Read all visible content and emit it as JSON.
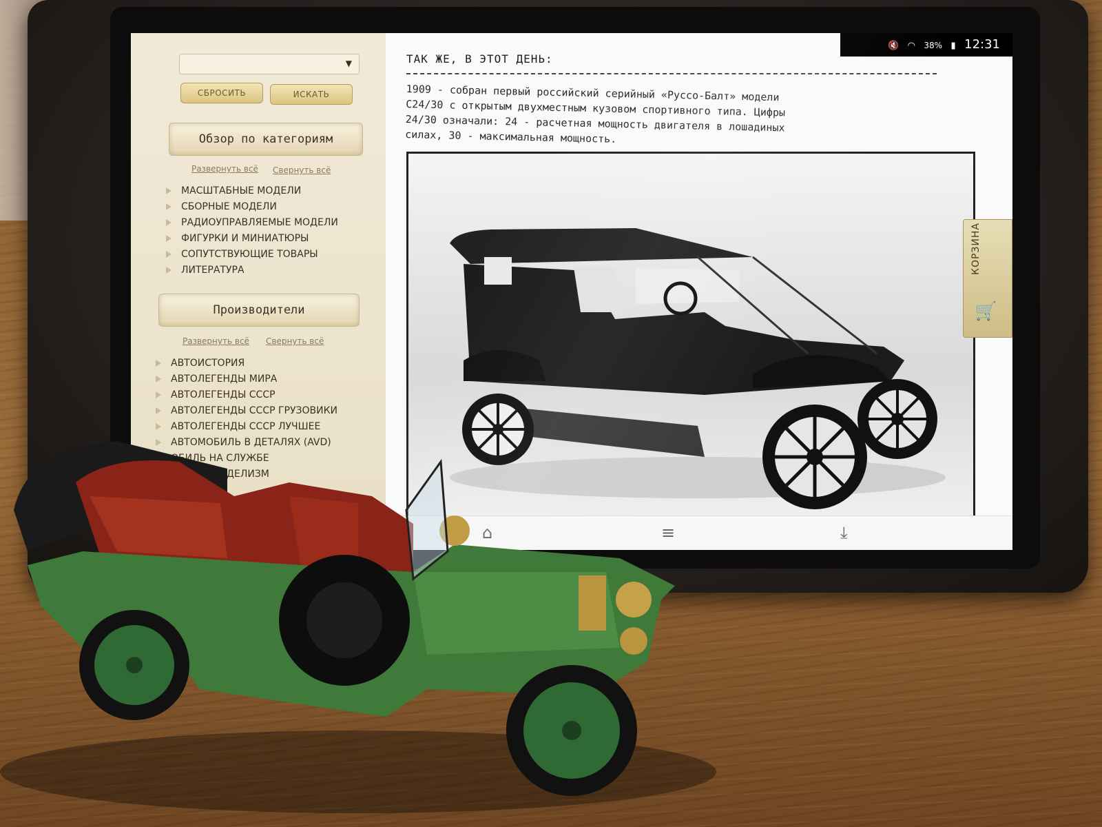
{
  "sidebar": {
    "reset_button": "СБРОСИТЬ",
    "search_button": "ИСКАТЬ",
    "categories_title": "Обзор по категориям",
    "categories_expand": "Развернуть всё",
    "categories_collapse": "Свернуть всё",
    "categories": [
      "МАСШТАБНЫЕ МОДЕЛИ",
      "СБОРНЫЕ МОДЕЛИ",
      "РАДИОУПРАВЛЯЕМЫЕ МОДЕЛИ",
      "ФИГУРКИ И МИНИАТЮРЫ",
      "СОПУТСТВУЮЩИЕ ТОВАРЫ",
      "ЛИТЕРАТУРА"
    ],
    "manufacturers_title": "Производители",
    "manufacturers_expand": "Развернуть всё",
    "manufacturers_collapse": "Свернуть всё",
    "manufacturers": [
      "АВТОИСТОРИЯ",
      "АВТОЛЕГЕНДЫ МИРА",
      "АВТОЛЕГЕНДЫ СССР",
      "АВТОЛЕГЕНДЫ СССР ГРУЗОВИКИ",
      "АВТОЛЕГЕНДЫ СССР ЛУЧШЕЕ",
      "АВТОМОБИЛЬ В ДЕТАЛЯХ (AVD)",
      "ОБИЛЬ НА СЛУЖБЕ",
      "ЛЬНЫЙ МОДЕЛИЗМ"
    ]
  },
  "status_bar": {
    "battery": "38%",
    "time": "12:31"
  },
  "article": {
    "heading": "ТАК ЖЕ, В ЭТОТ ДЕНЬ:",
    "lines": [
      "1909 - собран первый российский серийный «Руссо-Балт» модели",
      "С24/30 с открытым двухместным кузовом спортивного типа. Цифры",
      "24/30 означали: 24 - расчетная мощность двигателя в лошадиных",
      "силах, 30 - максимальная мощность."
    ]
  },
  "cart": {
    "label": "КОРЗИНА"
  },
  "icons": {
    "volume": "volume-icon",
    "wifi": "wifi-icon",
    "battery": "battery-icon",
    "cart": "cart-icon",
    "home": "home-icon",
    "menu": "menu-icon",
    "download": "download-icon"
  }
}
